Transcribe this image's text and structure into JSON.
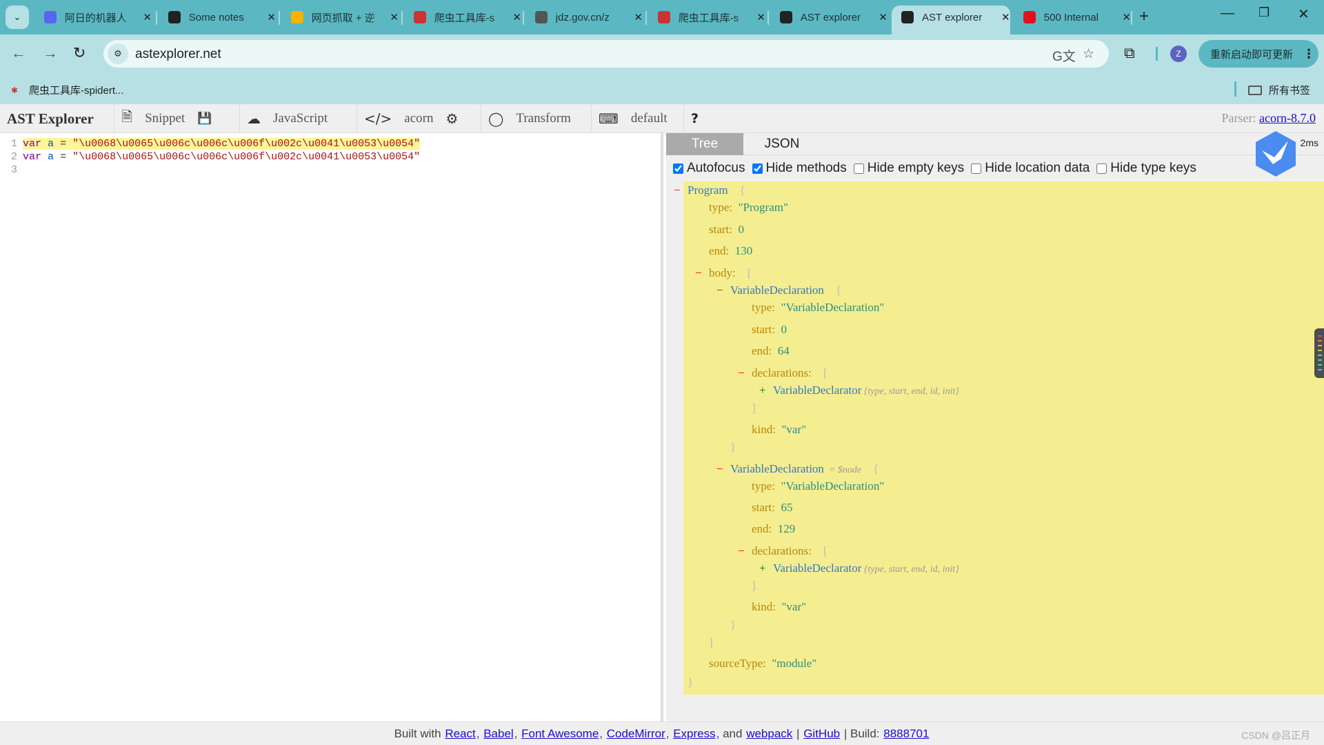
{
  "browser": {
    "tabs": [
      {
        "title": "阿日的机器人",
        "icon": "ghost-bot-icon",
        "color": "#5865f2"
      },
      {
        "title": "Some notes",
        "icon": "github-icon",
        "color": "#222222"
      },
      {
        "title": "网页抓取 + 逆",
        "icon": "syntax-icon",
        "color": "#f5b400"
      },
      {
        "title": "爬虫工具库-s",
        "icon": "spider-icon",
        "color": "#cc3333"
      },
      {
        "title": "jdz.gov.cn/z",
        "icon": "globe-icon",
        "color": "#555555"
      },
      {
        "title": "爬虫工具库-s",
        "icon": "spider-icon",
        "color": "#cc3333"
      },
      {
        "title": "AST explorer",
        "icon": "ast-icon",
        "color": "#222222"
      },
      {
        "title": "AST explorer",
        "icon": "ast-icon",
        "color": "#222222",
        "active": true
      },
      {
        "title": "500 Internal",
        "icon": "p-icon",
        "color": "#e0111b"
      }
    ],
    "close_glyph": "✕",
    "new_tab": "+",
    "url": "astexplorer.net",
    "avatar_letter": "Z",
    "update_label": "重新启动即可更新",
    "bookmarks": [
      {
        "label": "爬虫工具库-spidert..."
      }
    ],
    "all_bookmarks": "所有书签"
  },
  "toolbar": {
    "brand": "AST Explorer",
    "snippet": "Snippet",
    "language": "JavaScript",
    "parser_name": "acorn",
    "transform": "Transform",
    "keymap": "default",
    "help": "?",
    "parser_label": "Parser:",
    "parser_version": "acorn-8.7.0"
  },
  "editor": {
    "lines": [
      {
        "num": "1",
        "kw": "var",
        "name": "a",
        "op": "=",
        "str": "\"\\u0068\\u0065\\u006c\\u006c\\u006f\\u002c\\u0041\\u0053\\u0054\"",
        "highlight": true
      },
      {
        "num": "2",
        "kw": "var",
        "name": "a",
        "op": "=",
        "str": "\"\\u0068\\u0065\\u006c\\u006c\\u006f\\u002c\\u0041\\u0053\\u0054\"",
        "highlight": false
      },
      {
        "num": "3",
        "kw": "",
        "name": "",
        "op": "",
        "str": "",
        "highlight": false
      }
    ]
  },
  "output": {
    "tabs": [
      "Tree",
      "JSON"
    ],
    "active_tab": "Tree",
    "timing": "2ms",
    "options": [
      {
        "label": "Autofocus",
        "checked": true
      },
      {
        "label": "Hide methods",
        "checked": true
      },
      {
        "label": "Hide empty keys",
        "checked": false
      },
      {
        "label": "Hide location data",
        "checked": false
      },
      {
        "label": "Hide type keys",
        "checked": false
      }
    ],
    "tree": {
      "root": "Program",
      "type": "\"Program\"",
      "start": "0",
      "end": "130",
      "body_key": "body:",
      "decls": [
        {
          "name": "VariableDeclaration",
          "tag": "",
          "type": "\"VariableDeclaration\"",
          "start": "0",
          "end": "64",
          "child": "VariableDeclarator",
          "child_summary": "{type, start, end, id, init}",
          "kind": "\"var\""
        },
        {
          "name": "VariableDeclaration",
          "tag": "= $node",
          "type": "\"VariableDeclaration\"",
          "start": "65",
          "end": "129",
          "child": "VariableDeclarator",
          "child_summary": "{type, start, end, id, init}",
          "kind": "\"var\""
        }
      ],
      "sourceType": "\"module\""
    }
  },
  "footer": {
    "prefix": "Built with",
    "links": [
      "React",
      "Babel",
      "Font Awesome",
      "CodeMirror",
      "Express",
      "webpack"
    ],
    "and": "and",
    "github": "GitHub",
    "build_label": "Build:",
    "build": "8888701"
  },
  "watermark": "CSDN @吕正月"
}
